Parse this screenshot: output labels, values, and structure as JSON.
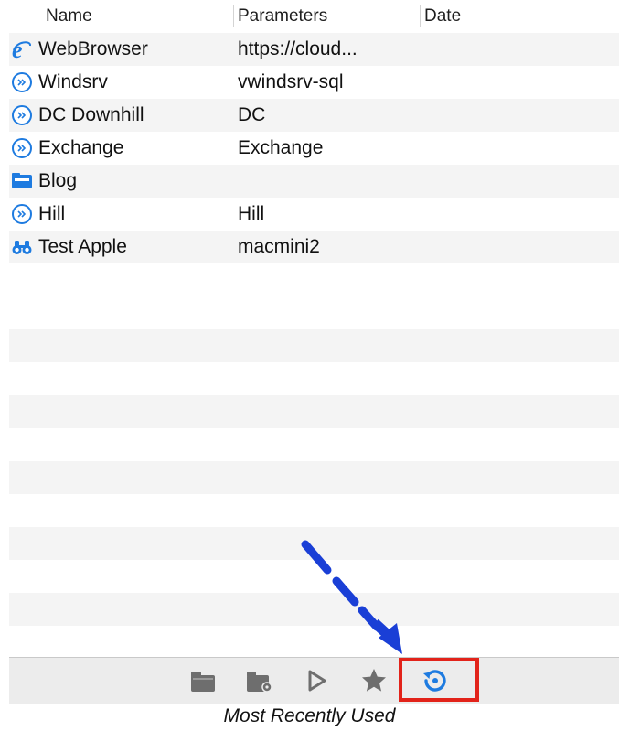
{
  "columns": {
    "name": "Name",
    "parameters": "Parameters",
    "date": "Date"
  },
  "connections": [
    {
      "name": "WebBrowser",
      "parameters": "https://cloud...",
      "icon": "internet-explorer-icon",
      "selected": true
    },
    {
      "name": "Windsrv",
      "parameters": "vwindsrv-sql",
      "icon": "remote-desktop-icon"
    },
    {
      "name": "DC Downhill",
      "parameters": "DC",
      "icon": "remote-desktop-icon"
    },
    {
      "name": "Exchange",
      "parameters": "Exchange",
      "icon": "remote-desktop-icon"
    },
    {
      "name": "Blog",
      "parameters": "",
      "icon": "ftp-folder-icon"
    },
    {
      "name": "Hill",
      "parameters": "Hill",
      "icon": "remote-desktop-icon"
    },
    {
      "name": "Test Apple",
      "parameters": "macmini2",
      "icon": "vnc-binoculars-icon"
    }
  ],
  "toolbar": {
    "buttons": [
      "open-folder-icon",
      "folder-settings-icon",
      "play-icon",
      "favorites-star-icon",
      "recent-history-icon"
    ],
    "active": "recent-history-icon"
  },
  "caption": "Most Recently Used",
  "colors": {
    "accent": "#1e7be0",
    "highlight": "#e2231a",
    "arrow": "#1a3fd6",
    "selected_row": "#e4e4e4"
  }
}
